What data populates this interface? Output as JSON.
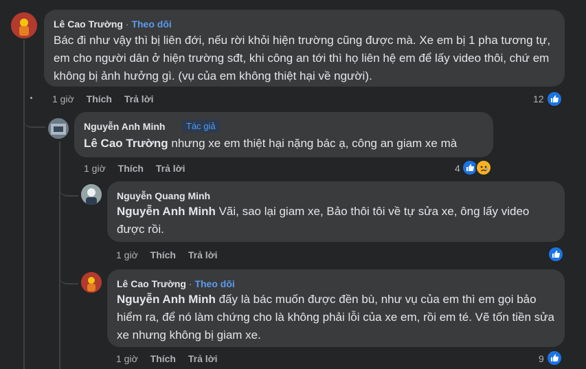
{
  "comments": [
    {
      "author": "Lê Cao Trường",
      "follow_label": "Theo dõi",
      "separator": "·",
      "text": "Bác đi như vậy thì bị liên đới, nếu rời khỏi hiện trường cũng được mà. Xe em bị 1 pha tương tự, em cho người dân ở hiện trường sđt, khi công an tới thì họ liên hệ em để lấy video thôi, chứ em không bị ảnh hưởng gì. (vụ của em không thiệt hại về người).",
      "time": "1 giờ",
      "like_label": "Thích",
      "reply_label": "Trả lời",
      "reaction_count": "12",
      "reactions": [
        "like-icon"
      ]
    },
    {
      "author": "Nguyễn Anh Minh",
      "badge": "Tác giả",
      "mention": "Lê Cao Trường",
      "text": " nhưng xe em thiệt hại nặng bác ạ, công an giam xe mà",
      "time": "1 giờ",
      "like_label": "Thích",
      "reply_label": "Trả lời",
      "reaction_count": "4",
      "reactions": [
        "like-icon",
        "sad-face-icon"
      ]
    },
    {
      "author": "Nguyễn Quang Minh",
      "mention": "Nguyễn Anh Minh",
      "text": " Vãi, sao lại giam xe, Bảo thôi tôi về tự sửa xe, ông lấy video được rồi.",
      "time": "1 giờ",
      "like_label": "Thích",
      "reply_label": "Trả lời",
      "reaction_count": "",
      "reactions": [
        "like-icon"
      ]
    },
    {
      "author": "Lê Cao Trường",
      "follow_label": "Theo dõi",
      "separator": "·",
      "mention": "Nguyễn Anh Minh",
      "text": " đấy là bác muốn được đền bù, như vụ của em thì em gọi bảo hiểm ra, để nó làm chứng cho là không phải lỗi của xe em, rồi em té. Vẽ tốn tiền sửa xe nhưng không bị giam xe.",
      "time": "1 giờ",
      "like_label": "Thích",
      "reply_label": "Trả lời",
      "reaction_count": "9",
      "reactions": [
        "like-icon"
      ]
    }
  ],
  "colors": {
    "background": "#242526",
    "bubble": "#3a3b3c",
    "link": "#5b9bf2",
    "like": "#1b74e4",
    "sad": "#f7b125"
  }
}
